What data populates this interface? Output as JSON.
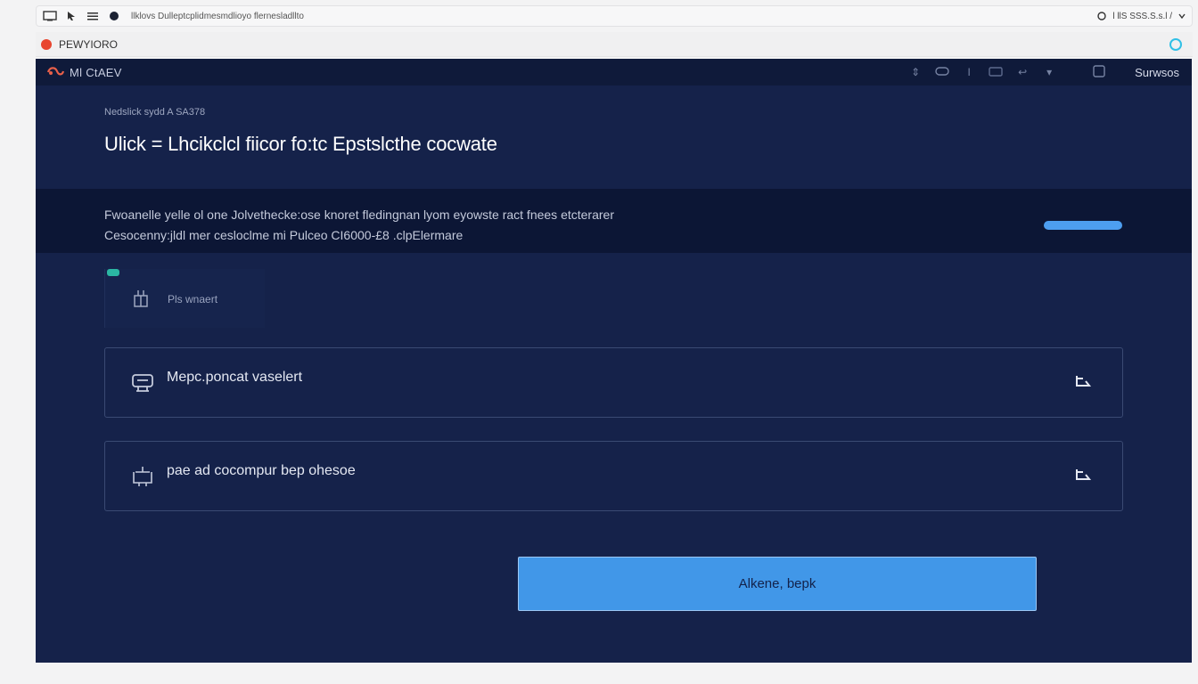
{
  "browser": {
    "url": "llklovs Dulleptcplidmesmdlioyo flernesladllto",
    "right_text": "l llS SSS.S.s.l /",
    "tab_label": "PEWYIORO"
  },
  "app": {
    "title": "Ml CtAEV",
    "sign_in": "Surwsos"
  },
  "header": {
    "eyebrow": "Nedslick sydd A SA378",
    "title": "Ulick = Lhcikclcl fiicor fo:tc Epstslcthe cocwate"
  },
  "banner": {
    "line1": "Fwoanelle yelle ol one Jolvethecke:ose knoret fledingnan lyom eyowste ract fnees etcterarer",
    "line2": "Cesocenny:jldl mer cesloclme mi Pulceo CI6000-£8 .clpElermare",
    "progress": 1.0
  },
  "status_card": {
    "label": "Pls wnaert",
    "led_color": "#2bb7a3"
  },
  "rows": [
    {
      "label": "Mepc.poncat vaselert",
      "icon": "router-icon"
    },
    {
      "label": "pae ad cocompur bep ohesoe",
      "icon": "network-node-icon"
    }
  ],
  "cta": {
    "label": "Alkene, bepk"
  },
  "colors": {
    "background": "#15224a",
    "banner": "#0c1635",
    "accent": "#4197e8",
    "record": "#e8452f"
  }
}
